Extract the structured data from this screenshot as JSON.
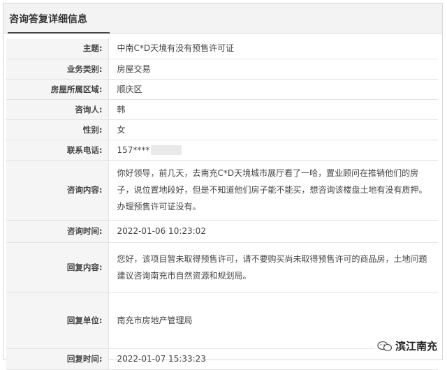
{
  "panel": {
    "title": "咨询答复详细信息"
  },
  "rows": [
    {
      "label": "主题:",
      "value": "中南C*D天境有没有预售许可证"
    },
    {
      "label": "业务类别:",
      "value": "房屋交易"
    },
    {
      "label": "房屋所属区域:",
      "value": "顺庆区"
    },
    {
      "label": "咨询人:",
      "value": "韩"
    },
    {
      "label": "性别:",
      "value": "女"
    },
    {
      "label": "联系电话:",
      "value": "157****"
    },
    {
      "label": "咨询内容:",
      "value": "你好领导，前几天，去南充C*D天境城市展厅看了一哈，置业顾问在推销他们的房子，说位置地段好，但是不知道他们房子能不能买，想咨询该楼盘土地有没有质押。办理预售许可证没有。"
    },
    {
      "label": "咨询时间:",
      "value": "2022-01-06 10:23:02"
    },
    {
      "label": "回复内容:",
      "value": "您好，该项目暂未取得预售许可，请不要购买尚未取得预售许可的商品房，土地问题建议咨询南充市自然资源和规划局。"
    },
    {
      "label": "回复单位:",
      "value": "南充市房地产管理局"
    },
    {
      "label": "回复时间:",
      "value": "2022-01-07 15:33:23"
    }
  ],
  "watermark": {
    "text": "滨江南充",
    "icon": "wechat-icon"
  }
}
